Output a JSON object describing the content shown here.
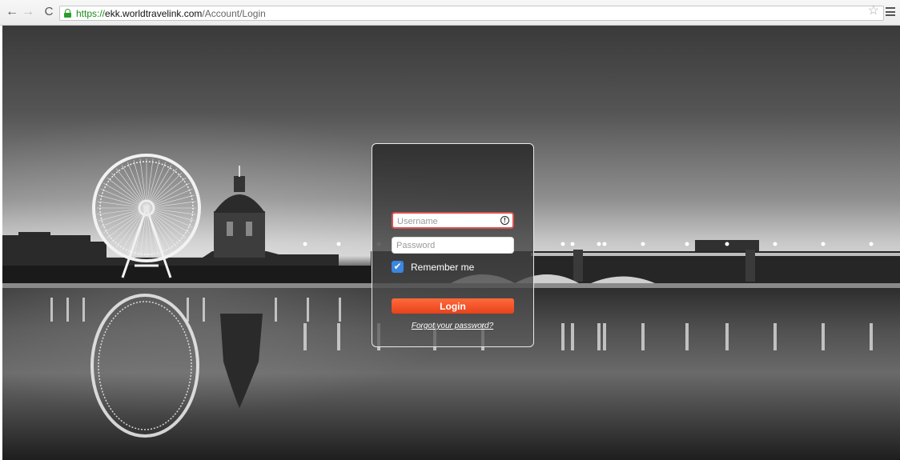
{
  "browser": {
    "url_scheme": "https://",
    "url_host": "ekk.worldtravelink.com",
    "url_path": "/Account/Login",
    "back_icon": "←",
    "forward_icon": "→",
    "reload_icon": "C",
    "star_icon": "☆"
  },
  "login": {
    "username_placeholder": "Username",
    "username_alert": "!",
    "password_placeholder": "Password",
    "remember_label": "Remember me",
    "remember_checked": true,
    "checkmark": "✔",
    "login_button": "Login",
    "forgot_link": "Forgot your password?",
    "username_error_color": "#d9534f",
    "button_color": "#f25a2b",
    "checkbox_color": "#3a86e0"
  }
}
